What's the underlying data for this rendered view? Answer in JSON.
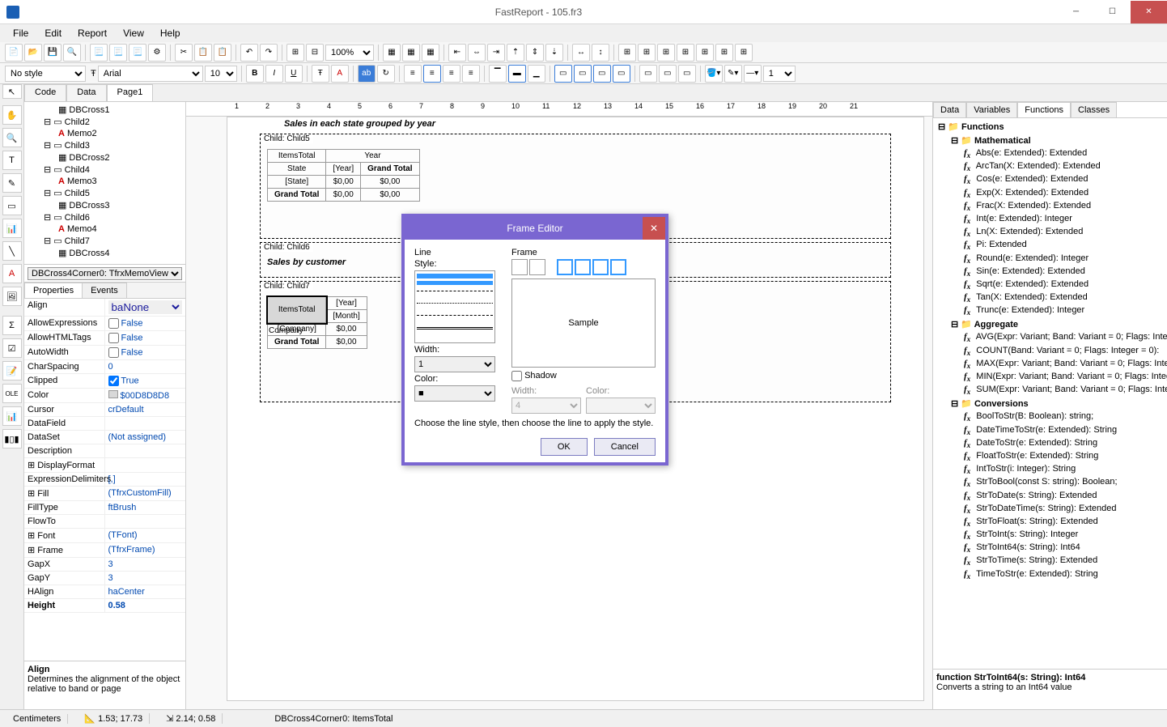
{
  "title": "FastReport - 105.fr3",
  "menu": [
    "File",
    "Edit",
    "Report",
    "View",
    "Help"
  ],
  "style_combo": "No style",
  "font_combo": "Arial",
  "size_combo": "10",
  "zoom": "100%",
  "tree_nodes": [
    {
      "lv": 2,
      "ico": "cross",
      "txt": "DBCross1"
    },
    {
      "lv": 1,
      "ico": "chld",
      "txt": "Child2"
    },
    {
      "lv": 2,
      "ico": "memo",
      "txt": "Memo2"
    },
    {
      "lv": 1,
      "ico": "chld",
      "txt": "Child3"
    },
    {
      "lv": 2,
      "ico": "cross",
      "txt": "DBCross2"
    },
    {
      "lv": 1,
      "ico": "chld",
      "txt": "Child4"
    },
    {
      "lv": 2,
      "ico": "memo",
      "txt": "Memo3"
    },
    {
      "lv": 1,
      "ico": "chld",
      "txt": "Child5"
    },
    {
      "lv": 2,
      "ico": "cross",
      "txt": "DBCross3"
    },
    {
      "lv": 1,
      "ico": "chld",
      "txt": "Child6"
    },
    {
      "lv": 2,
      "ico": "memo",
      "txt": "Memo4"
    },
    {
      "lv": 1,
      "ico": "chld",
      "txt": "Child7"
    },
    {
      "lv": 2,
      "ico": "cross",
      "txt": "DBCross4"
    }
  ],
  "obj_sel": "DBCross4Corner0: TfrxMemoView",
  "prop_tabs": [
    "Properties",
    "Events"
  ],
  "props": [
    {
      "n": "Align",
      "v": "baNone",
      "sel": true
    },
    {
      "n": "AllowExpressions",
      "v": "False",
      "chk": false
    },
    {
      "n": "AllowHTMLTags",
      "v": "False",
      "chk": false
    },
    {
      "n": "AutoWidth",
      "v": "False",
      "chk": false
    },
    {
      "n": "CharSpacing",
      "v": "0"
    },
    {
      "n": "Clipped",
      "v": "True",
      "chk": true
    },
    {
      "n": "Color",
      "v": "$00D8D8D8",
      "swatch": "#d8d8d8"
    },
    {
      "n": "Cursor",
      "v": "crDefault"
    },
    {
      "n": "DataField",
      "v": ""
    },
    {
      "n": "DataSet",
      "v": "(Not assigned)"
    },
    {
      "n": "Description",
      "v": ""
    },
    {
      "n": "DisplayFormat",
      "v": "",
      "exp": true
    },
    {
      "n": "ExpressionDelimiters",
      "v": "[,]"
    },
    {
      "n": "Fill",
      "v": "(TfrxCustomFill)",
      "exp": true
    },
    {
      "n": "FillType",
      "v": "ftBrush"
    },
    {
      "n": "FlowTo",
      "v": ""
    },
    {
      "n": "Font",
      "v": "(TFont)",
      "exp": true
    },
    {
      "n": "Frame",
      "v": "(TfrxFrame)",
      "exp": true
    },
    {
      "n": "GapX",
      "v": "3"
    },
    {
      "n": "GapY",
      "v": "3"
    },
    {
      "n": "HAlign",
      "v": "haCenter"
    },
    {
      "n": "Height",
      "v": "0.58",
      "bold": true
    }
  ],
  "prop_help_title": "Align",
  "prop_help_text": "Determines the alignment of the object relative to band or page",
  "page_tabs": [
    "Code",
    "Data",
    "Page1"
  ],
  "bands": {
    "title_text": "Sales in each state grouped by year",
    "c5": {
      "label": "Child: Child5",
      "corner": "ItemsTotal",
      "colh": "Year",
      "rowh": "State",
      "coldata": "[Year]",
      "gtlabel": "Grand Total",
      "rowdata": "[State]",
      "v": "$0,00"
    },
    "c6": {
      "label": "Child: Child6",
      "txt": "Sales by customer"
    },
    "c7": {
      "label": "Child: Child7",
      "corner": "ItemsTotal",
      "rowh": "Company",
      "coly": "[Year]",
      "colm": "[Month]",
      "rowdata": "[Company]",
      "v": "$0,00",
      "gt": "Grand Total"
    }
  },
  "right_tabs": [
    "Data",
    "Variables",
    "Functions",
    "Classes"
  ],
  "func_root": "Functions",
  "func_groups": [
    {
      "name": "Mathematical",
      "items": [
        "Abs(e: Extended): Extended",
        "ArcTan(X: Extended): Extended",
        "Cos(e: Extended): Extended",
        "Exp(X: Extended): Extended",
        "Frac(X: Extended): Extended",
        "Int(e: Extended): Integer",
        "Ln(X: Extended): Extended",
        "Pi: Extended",
        "Round(e: Extended): Integer",
        "Sin(e: Extended): Extended",
        "Sqrt(e: Extended): Extended",
        "Tan(X: Extended): Extended",
        "Trunc(e: Extended): Integer"
      ]
    },
    {
      "name": "Aggregate",
      "items": [
        "AVG(Expr: Variant; Band: Variant = 0; Flags: Integer = 0):",
        "COUNT(Band: Variant = 0; Flags: Integer = 0):",
        "MAX(Expr: Variant; Band: Variant = 0; Flags: Integer = 0):",
        "MIN(Expr: Variant; Band: Variant = 0; Flags: Integer = 0):",
        "SUM(Expr: Variant; Band: Variant = 0; Flags: Integer = 0):"
      ]
    },
    {
      "name": "Conversions",
      "items": [
        "BoolToStr(B: Boolean): string;",
        "DateTimeToStr(e: Extended): String",
        "DateToStr(e: Extended): String",
        "FloatToStr(e: Extended): String",
        "IntToStr(i: Integer): String",
        "StrToBool(const S: string): Boolean;",
        "StrToDate(s: String): Extended",
        "StrToDateTime(s: String): Extended",
        "StrToFloat(s: String): Extended",
        "StrToInt(s: String): Integer",
        "StrToInt64(s: String): Int64",
        "StrToTime(s: String): Extended",
        "TimeToStr(e: Extended): String"
      ]
    }
  ],
  "func_help_sig": "function StrToInt64(s: String): Int64",
  "func_help_desc": "Converts a string to an Int64 value",
  "dialog": {
    "title": "Frame Editor",
    "line_lbl": "Line",
    "frame_lbl": "Frame",
    "style_lbl": "Style:",
    "width_lbl": "Width:",
    "color_lbl": "Color:",
    "shadow_lbl": "Shadow",
    "sample": "Sample",
    "width_val": "1",
    "shadow_width": "4",
    "hint": "Choose the line style, then choose the line to apply the style.",
    "ok": "OK",
    "cancel": "Cancel"
  },
  "status": {
    "units": "Centimeters",
    "pos": "1.53; 17.73",
    "size": "2.14; 0.58",
    "sel": "DBCross4Corner0: ItemsTotal"
  },
  "line_num": "1"
}
